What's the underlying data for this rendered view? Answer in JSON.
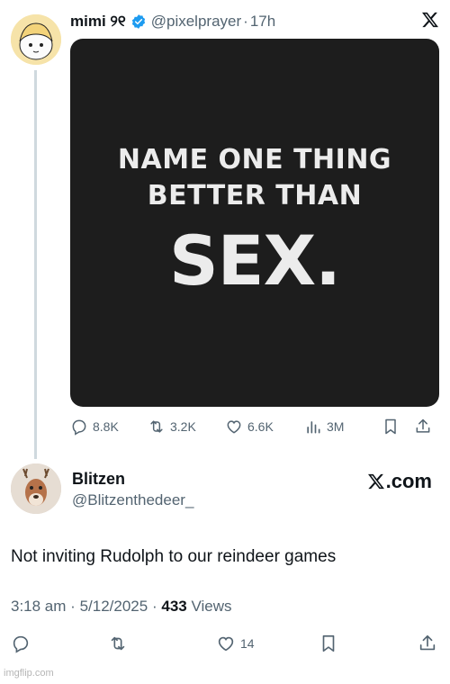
{
  "first_post": {
    "author_name": "mimi ୨୧",
    "handle": "@pixelprayer",
    "separator": "·",
    "time": "17h",
    "image_text": {
      "line1": "NAME ONE THING",
      "line2": "BETTER THAN",
      "line3": "SEX."
    },
    "stats": {
      "replies": "8.8K",
      "reposts": "3.2K",
      "likes": "6.6K",
      "views": "3M"
    }
  },
  "reply_post": {
    "author_name": "Blitzen",
    "handle": "@Blitzenthedeer_",
    "brand": ".com",
    "text": "Not inviting Rudolph to our reindeer games",
    "time": "3:18 am",
    "date": "5/12/2025",
    "separator": "·",
    "views_count": "433",
    "views_label": "Views",
    "likes": "14"
  },
  "watermark": "imgflip.com",
  "colors": {
    "verified": "#1d9bf0",
    "muted": "#536471",
    "thread_line": "#cfd9de",
    "image_bg": "#1d1d1d"
  },
  "icons": [
    "verified-badge-icon",
    "x-logo-icon",
    "reply-icon",
    "repost-icon",
    "like-icon",
    "views-icon",
    "bookmark-icon",
    "share-icon"
  ]
}
